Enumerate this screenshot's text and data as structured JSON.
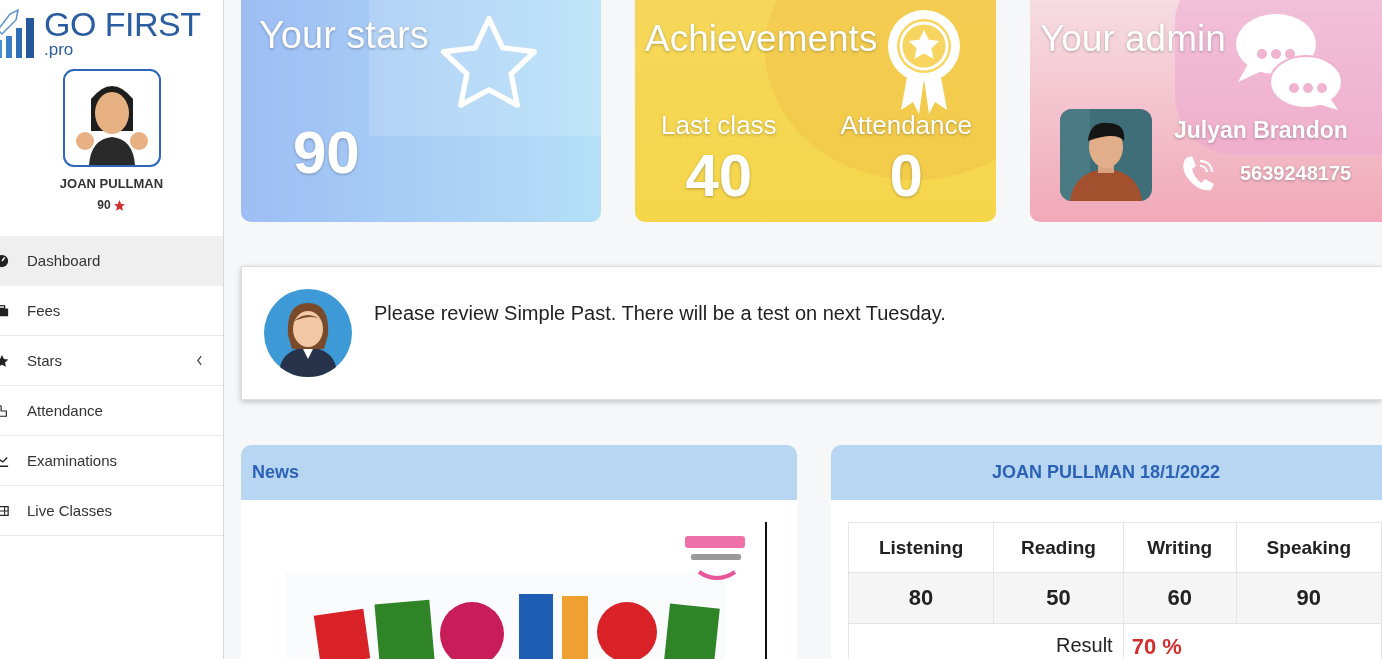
{
  "logo": {
    "name": "GO FIRST",
    "suffix": ".pro"
  },
  "profile": {
    "name": "JOAN PULLMAN",
    "stars": "90"
  },
  "menu": [
    {
      "label": "Dashboard",
      "kind": "dashboard",
      "selected": true,
      "expandable": false
    },
    {
      "label": "Fees",
      "kind": "briefcase",
      "selected": false,
      "expandable": false
    },
    {
      "label": "Stars",
      "kind": "star",
      "selected": false,
      "expandable": true
    },
    {
      "label": "Attendance",
      "kind": "hand",
      "selected": false,
      "expandable": false
    },
    {
      "label": "Examinations",
      "kind": "chart",
      "selected": false,
      "expandable": false
    },
    {
      "label": "Live Classes",
      "kind": "film",
      "selected": false,
      "expandable": false
    }
  ],
  "cards": [
    {
      "kind": "stars",
      "title": "Your stars",
      "value": "90"
    },
    {
      "kind": "achievements",
      "title": "Achievements",
      "stats": [
        {
          "label": "Last class",
          "value": "40"
        },
        {
          "label": "Attendance",
          "value": "0"
        }
      ]
    },
    {
      "kind": "admin",
      "title": "Your admin",
      "name": "Julyan Brandon",
      "phone": "5639248175"
    }
  ],
  "notice": {
    "text": "Please review Simple Past. There will be a test on next Tuesday."
  },
  "news": {
    "title": "News"
  },
  "report": {
    "title": "JOAN PULLMAN 18/1/2022",
    "columns": [
      "Listening",
      "Reading",
      "Writing",
      "Speaking"
    ],
    "scores": [
      "80",
      "50",
      "60",
      "90"
    ],
    "result_label": "Result",
    "result": "70 %"
  }
}
